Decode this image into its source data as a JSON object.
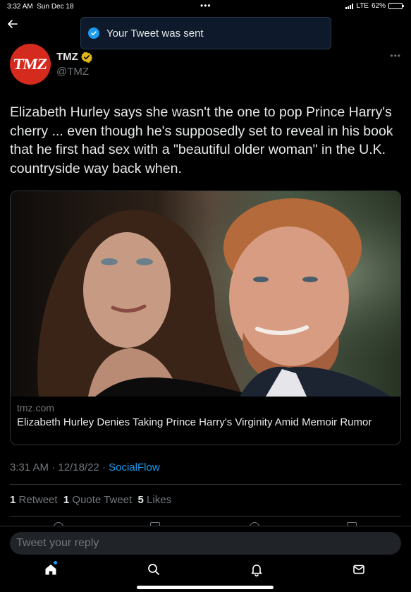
{
  "status_bar": {
    "time": "3:32 AM",
    "date": "Sun Dec 18",
    "network": "LTE",
    "battery": "62%",
    "battery_level": 0.62
  },
  "toast": {
    "message": "Your Tweet was sent",
    "icon": "check-circle-icon"
  },
  "tweet": {
    "avatar_text": "TMZ",
    "display_name": "TMZ",
    "handle": "@TMZ",
    "verified": true,
    "text": "Elizabeth Hurley says she wasn't the one to pop Prince Harry's cherry ... even though he's supposedly set to reveal in his book that he first had sex with a \"beautiful older woman\" in the U.K. countryside way back when.",
    "card": {
      "domain": "tmz.com",
      "title": "Elizabeth Hurley Denies Taking Prince Harry's Virginity Amid Memoir Rumor"
    },
    "time": "3:31 AM",
    "date": "12/18/22",
    "source": "SocialFlow",
    "stats": {
      "retweets": "1",
      "retweets_label": "Retweet",
      "quotes": "1",
      "quotes_label": "Quote Tweet",
      "likes": "5",
      "likes_label": "Likes"
    }
  },
  "reply": {
    "placeholder": "Tweet your reply"
  },
  "bottom_nav": [
    "home-icon",
    "search-icon",
    "notifications-icon",
    "messages-icon"
  ],
  "colors": {
    "background": "#000000",
    "accent": "#1d9bf0",
    "muted": "#71767b",
    "text": "#e7e9ea",
    "tmz_red": "#d42b1e"
  }
}
